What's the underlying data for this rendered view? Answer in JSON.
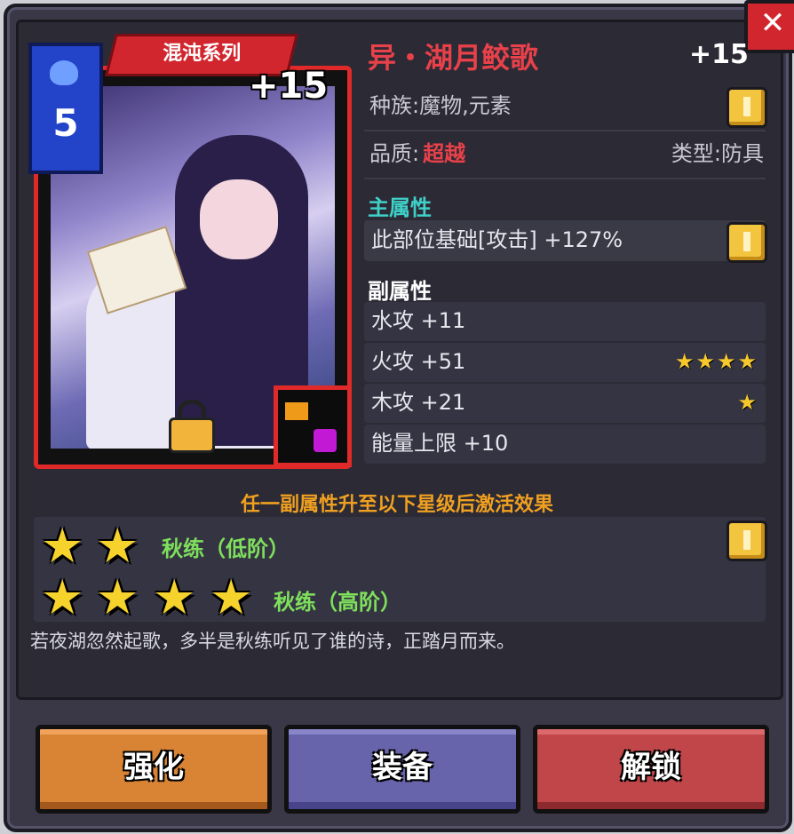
{
  "window": {
    "close_icon": "close-icon"
  },
  "card": {
    "level": "5",
    "series": "混沌系列",
    "plus": "+15"
  },
  "item": {
    "name": "异・湖月鲛歌",
    "plus": "+15",
    "race": "种族:魔物,元素",
    "quality_label": "品质:",
    "quality_value": "超越",
    "type": "类型:防具"
  },
  "main_attr": {
    "label": "主属性",
    "value": "此部位基础[攻击] +127%"
  },
  "sub_attr": {
    "label": "副属性",
    "rows": [
      {
        "text": "水攻 +11",
        "stars": ""
      },
      {
        "text": "火攻 +51",
        "stars": "★★★★"
      },
      {
        "text": "木攻 +21",
        "stars": "★"
      },
      {
        "text": "能量上限 +10",
        "stars": ""
      }
    ]
  },
  "set_effect": {
    "title": "任一副属性升至以下星级后激活效果",
    "tier1": "秋练（低阶）",
    "tier2": "秋练（高阶）",
    "star": "★"
  },
  "description": "若夜湖忽然起歌，多半是秋练听见了谁的诗，正踏月而来。",
  "buttons": {
    "enhance": "强化",
    "equip": "装备",
    "unlock": "解锁"
  },
  "colors": {
    "name_red": "#e8414a",
    "quality_red": "#e8414a",
    "main_attr_cyan": "#3fd0c8",
    "set_title_orange": "#f0a020",
    "set_name_green": "#7ee05c"
  }
}
